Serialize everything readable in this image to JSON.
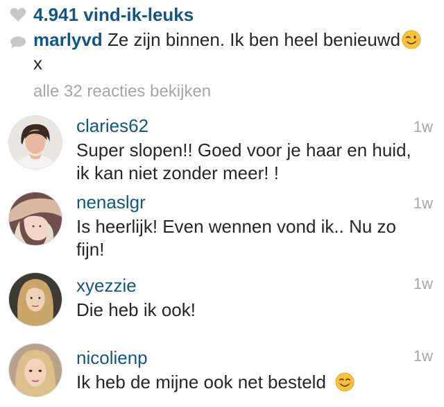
{
  "likes": {
    "icon": "heart-icon",
    "count_label": "4.941 vind-ik-leuks"
  },
  "caption": {
    "icon": "comment-bubble-icon",
    "username": "marlyvd",
    "text_before": "Ze zijn binnen. Ik ben heel benieuwd",
    "emoji": "winking-face-emoji",
    "text_after": "x"
  },
  "view_all_label": "alle 32 reacties bekijken",
  "comments": [
    {
      "username": "claries62",
      "text": "Super slopen!! Goed voor je haar en huid, ik kan niet zonder meer! !",
      "time": "1w"
    },
    {
      "username": "nenaslgr",
      "text": "Is heerlijk! Even wennen vond ik.. Nu zo fijn!",
      "time": "1w"
    },
    {
      "username": "xyezzie",
      "text": "Die heb ik ook!",
      "time": "1w"
    },
    {
      "username": "nicolienp",
      "text": "Ik heb de mijne ook net besteld",
      "emoji": "smiling-face-emoji",
      "time": "1w"
    }
  ],
  "colors": {
    "link": "#125688",
    "muted": "#a6a6a6",
    "text": "#262626"
  }
}
